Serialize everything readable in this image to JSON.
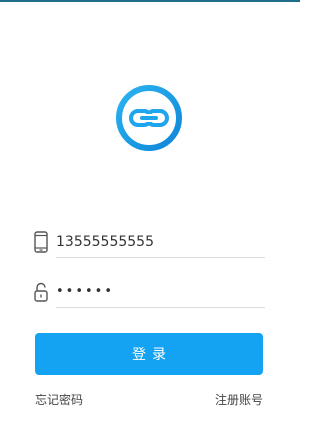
{
  "colors": {
    "accent": "#14a3f2",
    "logo_ring": "#1ea5ee",
    "status_bar": "#1f6e8c",
    "divider": "#dcdcdc",
    "icon": "#555555"
  },
  "logo": {
    "icon": "link-icon"
  },
  "form": {
    "phone": {
      "icon": "phone-icon",
      "value": "13555555555"
    },
    "password": {
      "icon": "lock-icon",
      "value": "••••••"
    },
    "login_label": "登录"
  },
  "links": {
    "forgot_password": "忘记密码",
    "register": "注册账号"
  }
}
